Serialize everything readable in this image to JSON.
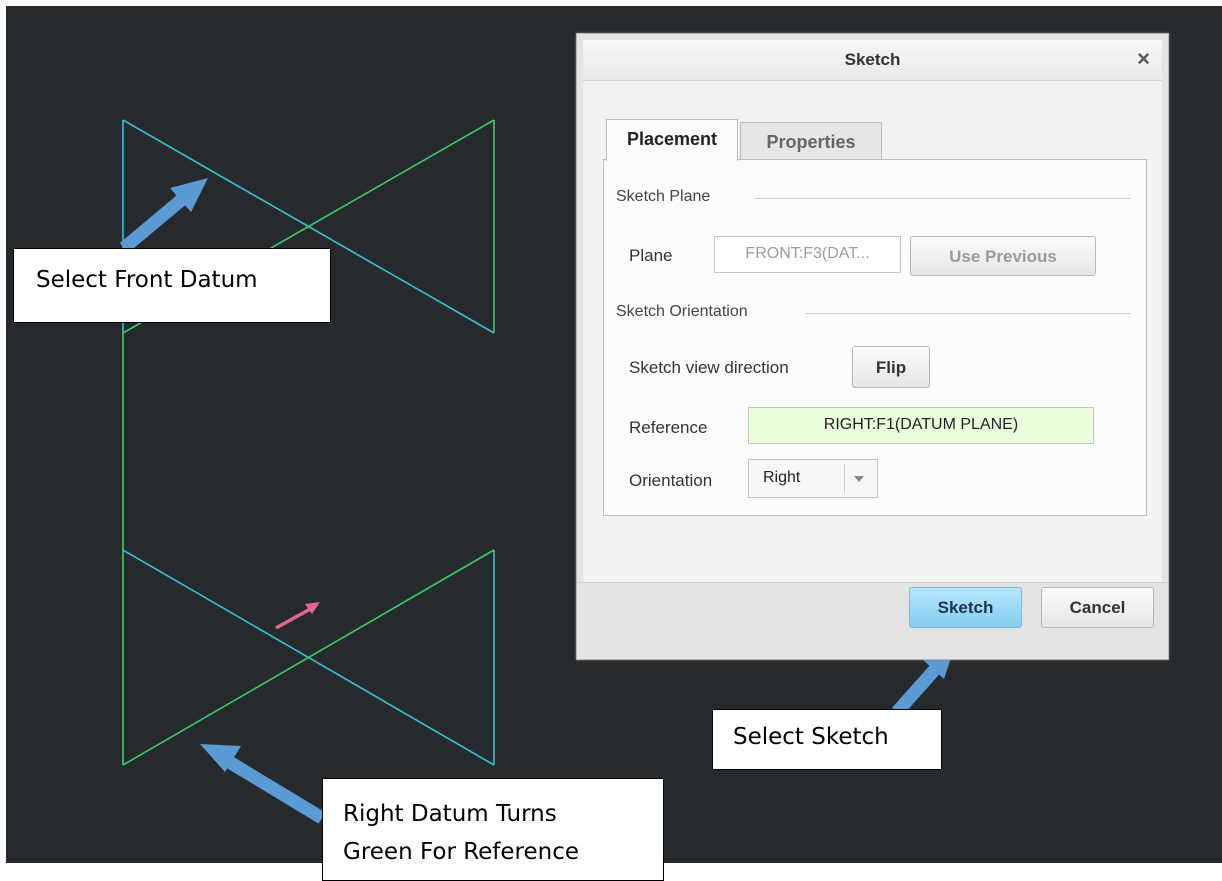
{
  "dialog": {
    "title": "Sketch",
    "close_glyph": "×",
    "tabs": [
      {
        "label": "Placement",
        "active": true
      },
      {
        "label": "Properties",
        "active": false
      }
    ],
    "sketch_plane": {
      "section_label": "Sketch Plane",
      "plane_label": "Plane",
      "plane_value": "FRONT:F3(DAT...",
      "use_previous_label": "Use Previous"
    },
    "sketch_orientation": {
      "section_label": "Sketch Orientation",
      "view_direction_label": "Sketch view direction",
      "flip_label": "Flip",
      "reference_label": "Reference",
      "reference_value": "RIGHT:F1(DATUM PLANE)",
      "orientation_label": "Orientation",
      "orientation_value": "Right"
    },
    "buttons": {
      "sketch_label": "Sketch",
      "cancel_label": "Cancel"
    }
  },
  "callouts": {
    "front": "Select Front Datum",
    "sketch": "Select Sketch",
    "right_line1": "Right Datum Turns",
    "right_line2": "Green For Reference"
  },
  "colors": {
    "viewport_bg": "#272a2d",
    "front_datum": "#35c4d4",
    "right_datum": "#3ccc6a",
    "arrow": "#5b9bd5",
    "direction_arrow": "#e0669b",
    "reference_field_bg": "#eaffdd",
    "primary_button": "#8fd3f4"
  }
}
